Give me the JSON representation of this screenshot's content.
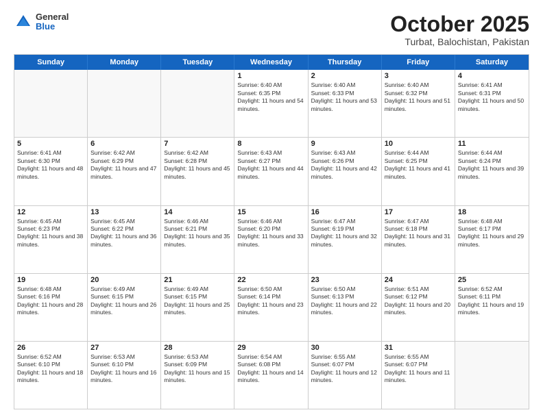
{
  "header": {
    "logo": {
      "general": "General",
      "blue": "Blue"
    },
    "title": "October 2025",
    "location": "Turbat, Balochistan, Pakistan"
  },
  "weekdays": [
    "Sunday",
    "Monday",
    "Tuesday",
    "Wednesday",
    "Thursday",
    "Friday",
    "Saturday"
  ],
  "rows": [
    [
      {
        "day": "",
        "sunrise": "",
        "sunset": "",
        "daylight": "",
        "empty": true
      },
      {
        "day": "",
        "sunrise": "",
        "sunset": "",
        "daylight": "",
        "empty": true
      },
      {
        "day": "",
        "sunrise": "",
        "sunset": "",
        "daylight": "",
        "empty": true
      },
      {
        "day": "1",
        "sunrise": "Sunrise: 6:40 AM",
        "sunset": "Sunset: 6:35 PM",
        "daylight": "Daylight: 11 hours and 54 minutes.",
        "empty": false
      },
      {
        "day": "2",
        "sunrise": "Sunrise: 6:40 AM",
        "sunset": "Sunset: 6:33 PM",
        "daylight": "Daylight: 11 hours and 53 minutes.",
        "empty": false
      },
      {
        "day": "3",
        "sunrise": "Sunrise: 6:40 AM",
        "sunset": "Sunset: 6:32 PM",
        "daylight": "Daylight: 11 hours and 51 minutes.",
        "empty": false
      },
      {
        "day": "4",
        "sunrise": "Sunrise: 6:41 AM",
        "sunset": "Sunset: 6:31 PM",
        "daylight": "Daylight: 11 hours and 50 minutes.",
        "empty": false
      }
    ],
    [
      {
        "day": "5",
        "sunrise": "Sunrise: 6:41 AM",
        "sunset": "Sunset: 6:30 PM",
        "daylight": "Daylight: 11 hours and 48 minutes.",
        "empty": false
      },
      {
        "day": "6",
        "sunrise": "Sunrise: 6:42 AM",
        "sunset": "Sunset: 6:29 PM",
        "daylight": "Daylight: 11 hours and 47 minutes.",
        "empty": false
      },
      {
        "day": "7",
        "sunrise": "Sunrise: 6:42 AM",
        "sunset": "Sunset: 6:28 PM",
        "daylight": "Daylight: 11 hours and 45 minutes.",
        "empty": false
      },
      {
        "day": "8",
        "sunrise": "Sunrise: 6:43 AM",
        "sunset": "Sunset: 6:27 PM",
        "daylight": "Daylight: 11 hours and 44 minutes.",
        "empty": false
      },
      {
        "day": "9",
        "sunrise": "Sunrise: 6:43 AM",
        "sunset": "Sunset: 6:26 PM",
        "daylight": "Daylight: 11 hours and 42 minutes.",
        "empty": false
      },
      {
        "day": "10",
        "sunrise": "Sunrise: 6:44 AM",
        "sunset": "Sunset: 6:25 PM",
        "daylight": "Daylight: 11 hours and 41 minutes.",
        "empty": false
      },
      {
        "day": "11",
        "sunrise": "Sunrise: 6:44 AM",
        "sunset": "Sunset: 6:24 PM",
        "daylight": "Daylight: 11 hours and 39 minutes.",
        "empty": false
      }
    ],
    [
      {
        "day": "12",
        "sunrise": "Sunrise: 6:45 AM",
        "sunset": "Sunset: 6:23 PM",
        "daylight": "Daylight: 11 hours and 38 minutes.",
        "empty": false
      },
      {
        "day": "13",
        "sunrise": "Sunrise: 6:45 AM",
        "sunset": "Sunset: 6:22 PM",
        "daylight": "Daylight: 11 hours and 36 minutes.",
        "empty": false
      },
      {
        "day": "14",
        "sunrise": "Sunrise: 6:46 AM",
        "sunset": "Sunset: 6:21 PM",
        "daylight": "Daylight: 11 hours and 35 minutes.",
        "empty": false
      },
      {
        "day": "15",
        "sunrise": "Sunrise: 6:46 AM",
        "sunset": "Sunset: 6:20 PM",
        "daylight": "Daylight: 11 hours and 33 minutes.",
        "empty": false
      },
      {
        "day": "16",
        "sunrise": "Sunrise: 6:47 AM",
        "sunset": "Sunset: 6:19 PM",
        "daylight": "Daylight: 11 hours and 32 minutes.",
        "empty": false
      },
      {
        "day": "17",
        "sunrise": "Sunrise: 6:47 AM",
        "sunset": "Sunset: 6:18 PM",
        "daylight": "Daylight: 11 hours and 31 minutes.",
        "empty": false
      },
      {
        "day": "18",
        "sunrise": "Sunrise: 6:48 AM",
        "sunset": "Sunset: 6:17 PM",
        "daylight": "Daylight: 11 hours and 29 minutes.",
        "empty": false
      }
    ],
    [
      {
        "day": "19",
        "sunrise": "Sunrise: 6:48 AM",
        "sunset": "Sunset: 6:16 PM",
        "daylight": "Daylight: 11 hours and 28 minutes.",
        "empty": false
      },
      {
        "day": "20",
        "sunrise": "Sunrise: 6:49 AM",
        "sunset": "Sunset: 6:15 PM",
        "daylight": "Daylight: 11 hours and 26 minutes.",
        "empty": false
      },
      {
        "day": "21",
        "sunrise": "Sunrise: 6:49 AM",
        "sunset": "Sunset: 6:15 PM",
        "daylight": "Daylight: 11 hours and 25 minutes.",
        "empty": false
      },
      {
        "day": "22",
        "sunrise": "Sunrise: 6:50 AM",
        "sunset": "Sunset: 6:14 PM",
        "daylight": "Daylight: 11 hours and 23 minutes.",
        "empty": false
      },
      {
        "day": "23",
        "sunrise": "Sunrise: 6:50 AM",
        "sunset": "Sunset: 6:13 PM",
        "daylight": "Daylight: 11 hours and 22 minutes.",
        "empty": false
      },
      {
        "day": "24",
        "sunrise": "Sunrise: 6:51 AM",
        "sunset": "Sunset: 6:12 PM",
        "daylight": "Daylight: 11 hours and 20 minutes.",
        "empty": false
      },
      {
        "day": "25",
        "sunrise": "Sunrise: 6:52 AM",
        "sunset": "Sunset: 6:11 PM",
        "daylight": "Daylight: 11 hours and 19 minutes.",
        "empty": false
      }
    ],
    [
      {
        "day": "26",
        "sunrise": "Sunrise: 6:52 AM",
        "sunset": "Sunset: 6:10 PM",
        "daylight": "Daylight: 11 hours and 18 minutes.",
        "empty": false
      },
      {
        "day": "27",
        "sunrise": "Sunrise: 6:53 AM",
        "sunset": "Sunset: 6:10 PM",
        "daylight": "Daylight: 11 hours and 16 minutes.",
        "empty": false
      },
      {
        "day": "28",
        "sunrise": "Sunrise: 6:53 AM",
        "sunset": "Sunset: 6:09 PM",
        "daylight": "Daylight: 11 hours and 15 minutes.",
        "empty": false
      },
      {
        "day": "29",
        "sunrise": "Sunrise: 6:54 AM",
        "sunset": "Sunset: 6:08 PM",
        "daylight": "Daylight: 11 hours and 14 minutes.",
        "empty": false
      },
      {
        "day": "30",
        "sunrise": "Sunrise: 6:55 AM",
        "sunset": "Sunset: 6:07 PM",
        "daylight": "Daylight: 11 hours and 12 minutes.",
        "empty": false
      },
      {
        "day": "31",
        "sunrise": "Sunrise: 6:55 AM",
        "sunset": "Sunset: 6:07 PM",
        "daylight": "Daylight: 11 hours and 11 minutes.",
        "empty": false
      },
      {
        "day": "",
        "sunrise": "",
        "sunset": "",
        "daylight": "",
        "empty": true
      }
    ]
  ]
}
